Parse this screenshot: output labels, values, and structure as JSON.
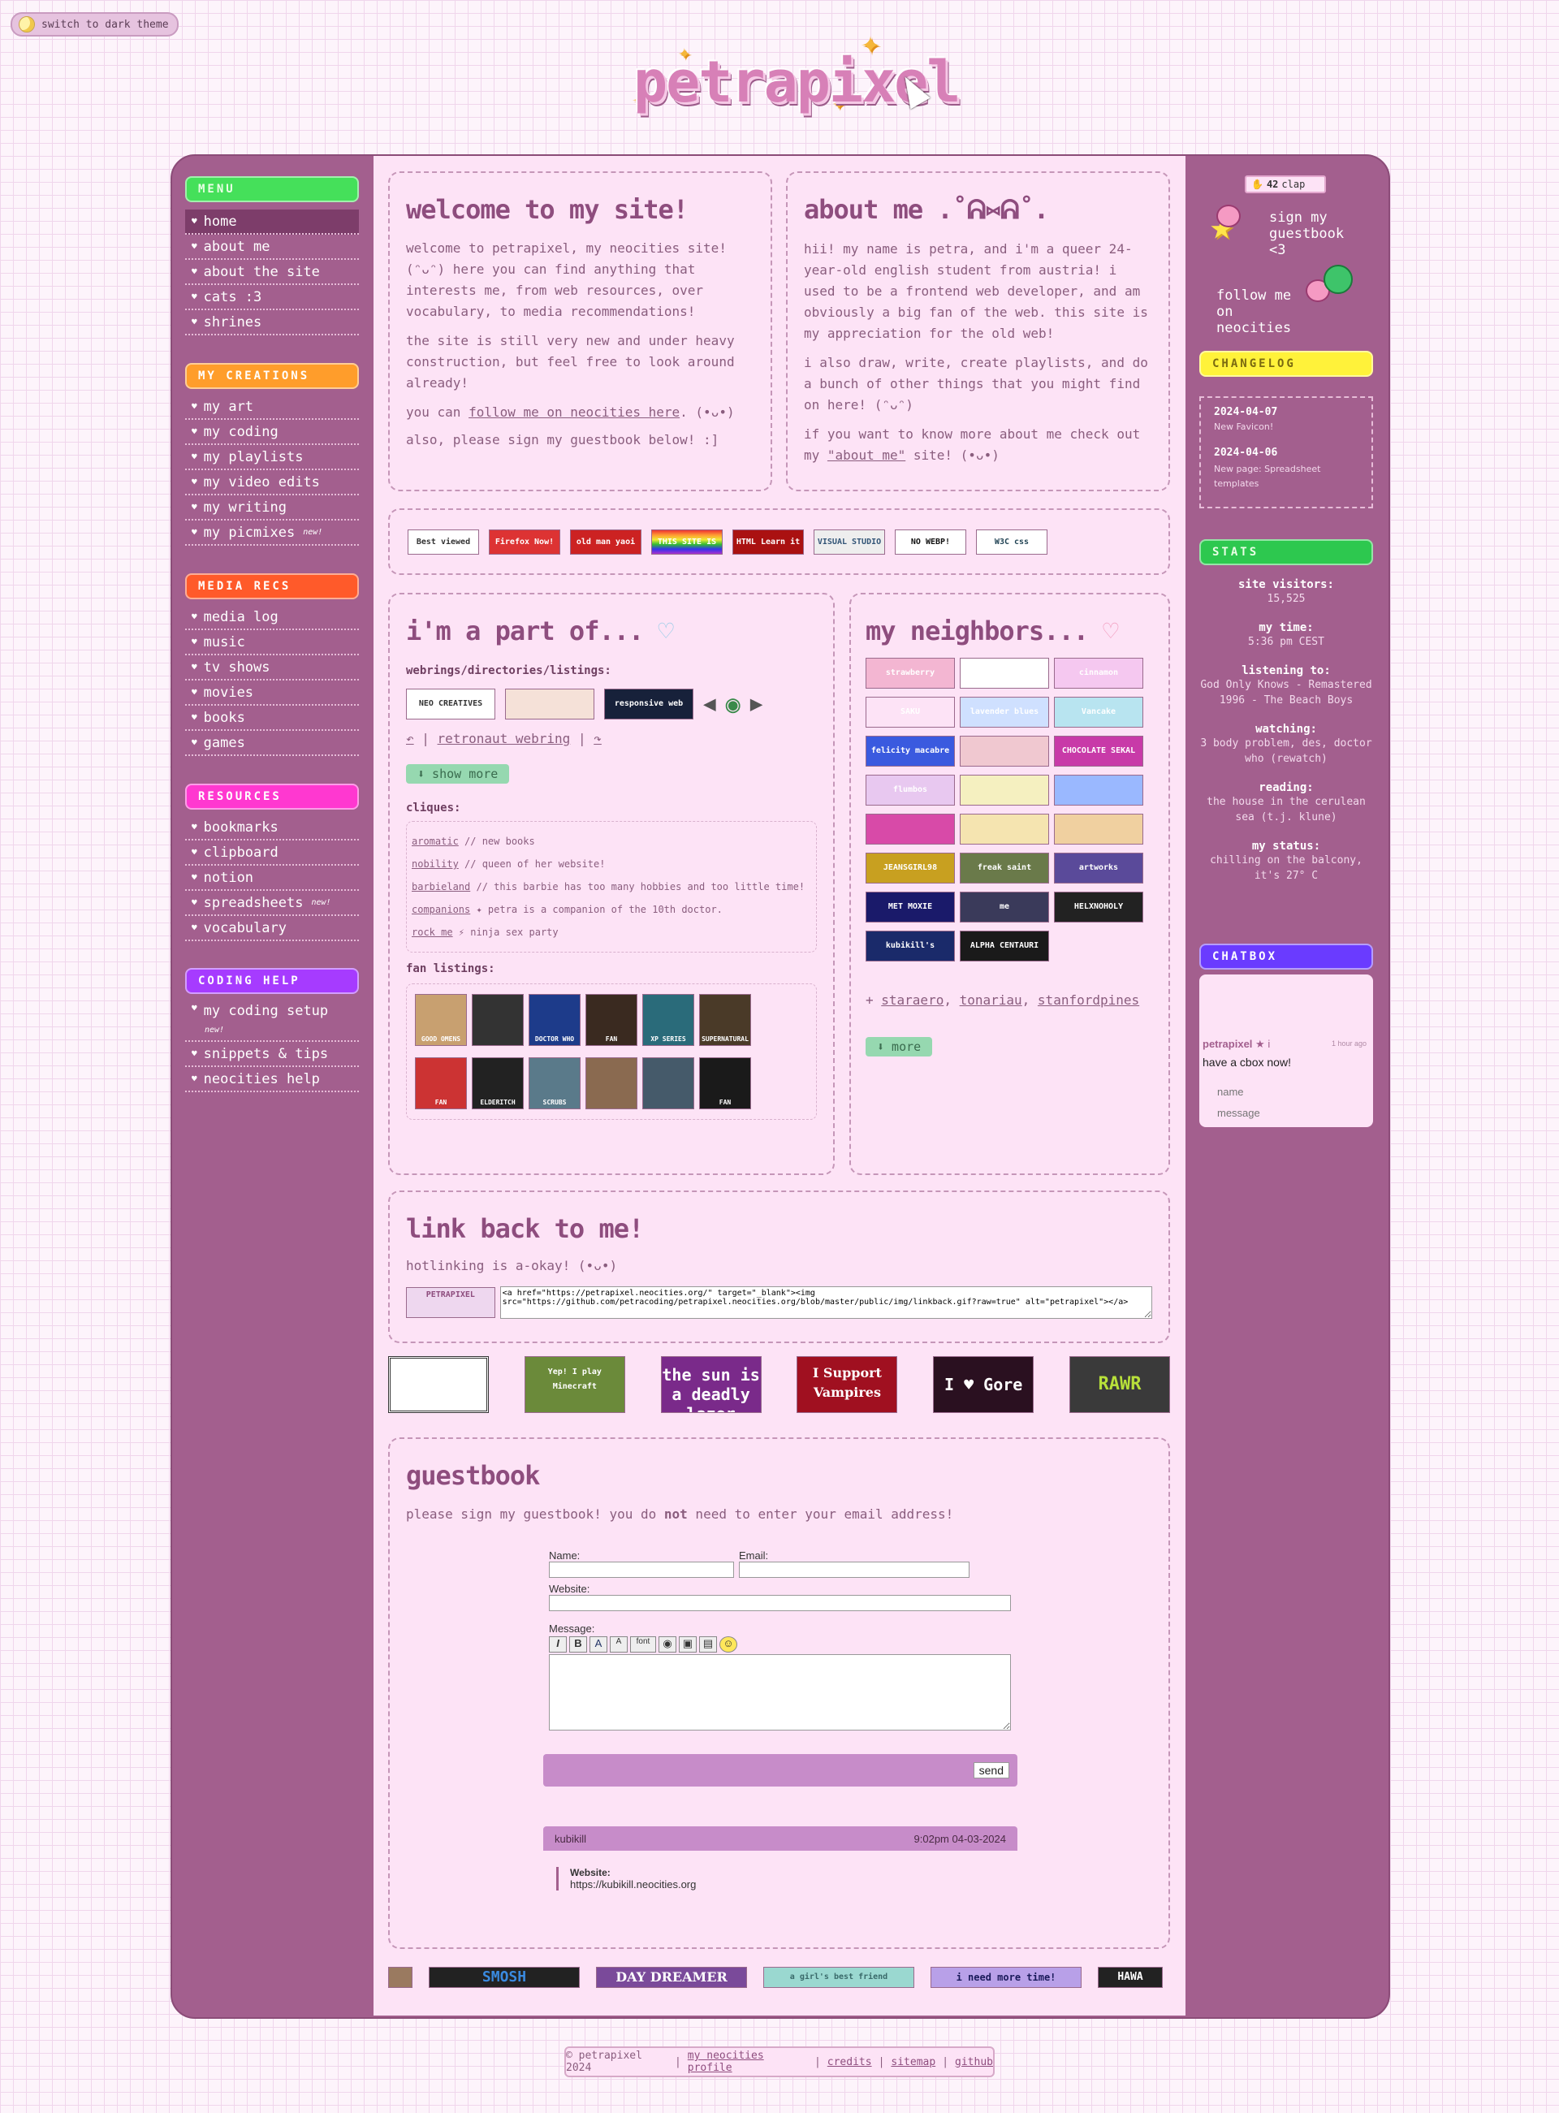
{
  "theme_toggle": "switch to dark theme",
  "logo": {
    "text": "petrapixel"
  },
  "menu": {
    "head": "MENU",
    "items": [
      "home",
      "about me",
      "about the site",
      "cats :3",
      "shrines"
    ],
    "creations_head": "MY CREATIONS",
    "creations": [
      "my art",
      "my coding",
      "my playlists",
      "my video edits",
      "my writing",
      "my picmixes"
    ],
    "media_head": "MEDIA RECS",
    "media": [
      "media log",
      "music",
      "tv shows",
      "movies",
      "books",
      "games"
    ],
    "resources_head": "RESOURCES",
    "resources": [
      "bookmarks",
      "clipboard",
      "notion",
      "spreadsheets",
      "vocabulary"
    ],
    "coding_head": "CODING HELP",
    "coding": [
      "my coding setup",
      "snippets & tips",
      "neocities help"
    ],
    "new_tag": "new!"
  },
  "welcome": {
    "title": "welcome to my site!",
    "p1": "welcome to petrapixel, my neocities site! (ᵔᴗᵔ) here you can find anything that interests me, from web resources, over vocabulary, to media recommendations!",
    "p2": "the site is still very new and under heavy construction, but feel free to look around already!",
    "p3a": "you can ",
    "p3link": "follow me on neocities here",
    "p3b": ". (•ᴗ•)",
    "p4": "also, please sign my guestbook below! :]"
  },
  "about": {
    "title": "about me .˚ᕱ⑅ᕱ˚.",
    "p1": "hii! my name is petra, and i'm a queer 24-year-old english student from austria! i used to be a frontend web developer, and am obviously a big fan of the web. this site is my appreciation for the old web!",
    "p2": "i also draw, write, create playlists, and do a bunch of other things that you might find on here! (ᵔᴗᵔ)",
    "p3a": "if you want to know more about me check out my ",
    "p3link": "\"about me\"",
    "p3b": " site! (•ᴗ•)"
  },
  "badges": [
    "Best viewed with A COMPUTER",
    "Firefox Now!",
    "old man yaoi Now!",
    "THIS SITE IS GAY",
    "HTML Learn it today!",
    "VISUAL STUDIO CODE",
    "NO WEBP!",
    "W3C css"
  ],
  "part_of": {
    "title": "i'm a part of...",
    "webrings_label": "webrings/directories/listings:",
    "webring_btns": [
      "NEO CREATIVES webring",
      "responsive web directory"
    ],
    "retronaut": "retronaut webring",
    "show_more": "⬇ show more",
    "cliques_label": "cliques:",
    "cliques": [
      {
        "name": "aromatic",
        "text": " // new books"
      },
      {
        "name": "nobility",
        "text": " // queen of her website!"
      },
      {
        "name": "barbieland",
        "text": " // this barbie has too many hobbies and too little time!"
      },
      {
        "name": "companions",
        "text": " ✦ petra is a companion of the 10th doctor."
      },
      {
        "name": "rock me",
        "text": " ⚡ ninja sex party"
      }
    ],
    "fan_label": "fan listings:",
    "fans": [
      "GOOD OMENS",
      "",
      "DOCTOR WHO",
      "FAN",
      "XP SERIES",
      "SUPERNATURAL",
      "FAN",
      "ELDERITCH",
      "SCRUBS",
      "",
      "",
      "FAN"
    ]
  },
  "neighbors": {
    "title": "my neighbors...",
    "buttons": [
      "strawberry",
      "",
      "cinnamon",
      "SAKU",
      "lavender blues",
      "Vancake",
      "felicity macabre",
      "",
      "CHOCOLATE SEKAL",
      "flumbos",
      "",
      "",
      "",
      "",
      "",
      "JEANSGIRL98",
      "freak saint",
      "artworks",
      "MET MOXIE",
      "me",
      "HELXNOHOLY",
      "kubikill's Cyberspace",
      "ALPHA CENTAURI"
    ],
    "plus": "+ ",
    "links": [
      "staraero",
      "tonariau",
      "stanfordpines"
    ],
    "more": "⬇ more"
  },
  "linkback": {
    "title": "link back to me!",
    "text": "hotlinking is a-okay! (•ᴗ•)",
    "code": "<a href=\"https://petrapixel.neocities.org/\" target=\"_blank\"><img src=\"https://github.com/petracoding/petrapixel.neocities.org/blob/master/public/img/linkback.gif?raw=true\" alt=\"petrapixel\"></a>",
    "button_label": "PETRAPIXEL"
  },
  "stamps": [
    "",
    "Yep! I play Minecraft",
    "the sun is a deadly lazer",
    "I Support Vampires",
    "I ♥ Gore",
    "RAWR"
  ],
  "guestbook": {
    "title": "guestbook",
    "intro_a": "please sign my guestbook! you do ",
    "intro_b": "not",
    "intro_c": " need to enter your email address!",
    "name_label": "Name:",
    "email_label": "Email:",
    "website_label": "Website:",
    "message_label": "Message:",
    "toolbar": [
      "I",
      "B",
      "A",
      "A",
      "font",
      "",
      "",
      "",
      ""
    ],
    "send": "send",
    "entry": {
      "author": "kubikill",
      "time": "9:02pm 04-03-2024",
      "website_label": "Website:",
      "website": "https://kubikill.neocities.org"
    }
  },
  "bottom_buttons": [
    "",
    "SMOSH",
    "DAY DREAMER",
    "a girl's best friend",
    "i need more time!",
    "HAWA"
  ],
  "right": {
    "clap_count": "42",
    "clap_label": "clap",
    "guestbook_link": "sign my guestbook <3",
    "follow_link": "follow me on neocities",
    "changelog_head": "CHANGELOG",
    "changelog": [
      {
        "date": "2024-04-07",
        "text": "New Favicon!"
      },
      {
        "date": "2024-04-06",
        "text": "New page: Spreadsheet templates"
      }
    ],
    "stats_head": "STATS",
    "stats": [
      {
        "label": "site visitors:",
        "value": "15,525"
      },
      {
        "label": "my time:",
        "value": "5:36 pm CEST"
      },
      {
        "label": "listening to:",
        "value": "God Only Knows - Remastered 1996 - The Beach Boys"
      },
      {
        "label": "watching:",
        "value": "3 body problem, des, doctor who (rewatch)"
      },
      {
        "label": "reading:",
        "value": "the house in the cerulean sea (t.j. klune)"
      },
      {
        "label": "my status:",
        "value": "chilling on the balcony, it's 27° C"
      }
    ],
    "chatbox_head": "CHATBOX",
    "chat": {
      "author": "petrapixel",
      "star": "★",
      "i": "i",
      "time": "1 hour ago",
      "message": "have a cbox now!",
      "name_ph": "name",
      "msg_ph": "message"
    }
  },
  "footer": {
    "copy": "© petrapixel 2024",
    "links": [
      "my neocities profile",
      "credits",
      "sitemap",
      "github"
    ]
  },
  "colors": {
    "frame": "#a35f8e",
    "panel": "#fde3f6",
    "menu_head": "#45e05a",
    "creations_head": "#ff9d2b",
    "media_head": "#ff5a2a",
    "resources_head": "#ff38d0",
    "coding_head": "#a63bff",
    "changelog_head": "#fff23a",
    "stats_head": "#2dc84f",
    "chatbox_head": "#6a3bff"
  }
}
